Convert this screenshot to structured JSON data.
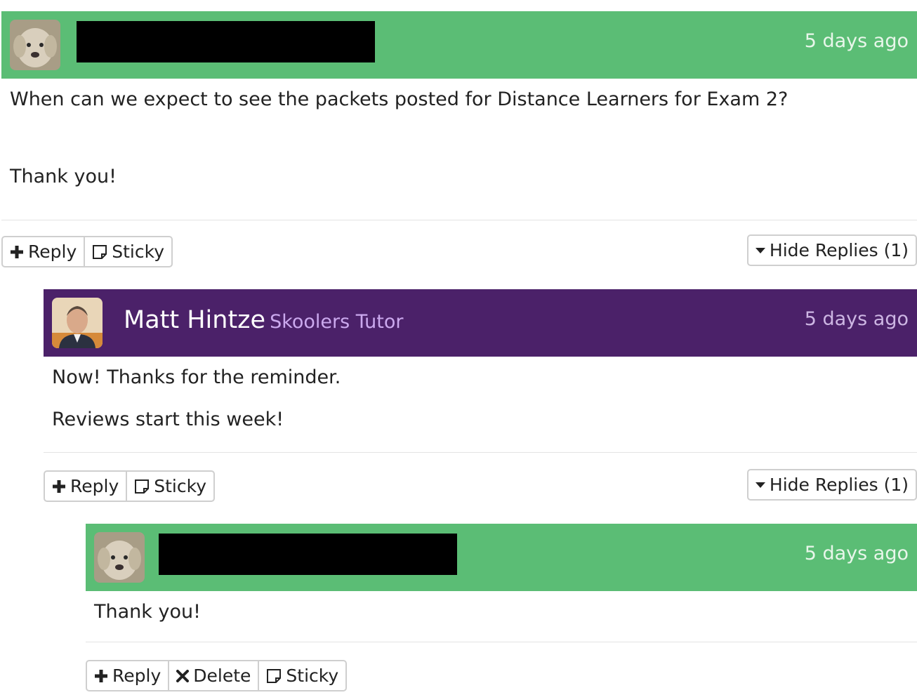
{
  "posts": [
    {
      "time": "5 days ago",
      "body": [
        "When can we expect to see the packets posted for Distance Learners for Exam 2?",
        "Thank you!"
      ],
      "actions": {
        "reply": "Reply",
        "sticky": "Sticky"
      },
      "hide_replies": "Hide Replies (1)"
    },
    {
      "author": "Matt Hintze",
      "role": "Skoolers Tutor",
      "time": "5 days ago",
      "body": [
        "Now!  Thanks for the reminder.",
        "Reviews start this week!"
      ],
      "actions": {
        "reply": "Reply",
        "sticky": "Sticky"
      },
      "hide_replies": "Hide Replies (1)"
    },
    {
      "time": "5 days ago",
      "body": [
        "Thank you!"
      ],
      "actions": {
        "reply": "Reply",
        "delete": "Delete",
        "sticky": "Sticky"
      }
    }
  ],
  "colors": {
    "student_header": "#5bbd75",
    "tutor_header": "#4b2169",
    "tutor_role": "#cba9ee"
  }
}
